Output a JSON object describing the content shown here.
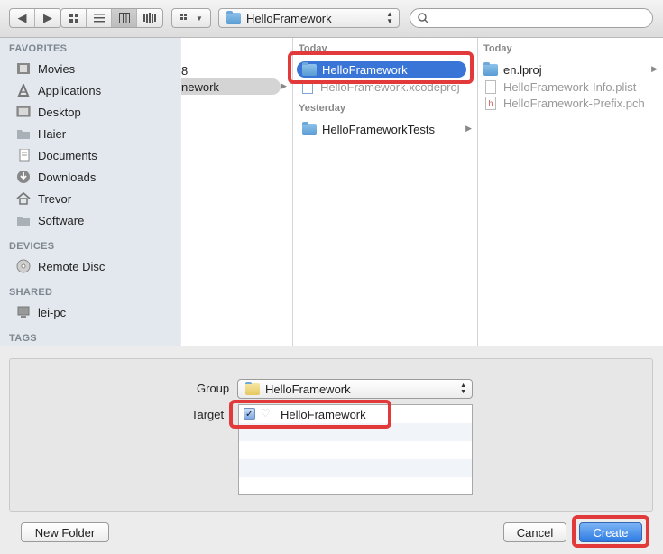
{
  "toolbar": {
    "path_label": "HelloFramework",
    "search_placeholder": ""
  },
  "sidebar": {
    "favorites_header": "FAVORITES",
    "favorites": [
      "Movies",
      "Applications",
      "Desktop",
      "Haier",
      "Documents",
      "Downloads",
      "Trevor",
      "Software"
    ],
    "devices_header": "DEVICES",
    "devices": [
      "Remote Disc"
    ],
    "shared_header": "SHARED",
    "shared": [
      "lei-pc"
    ],
    "tags_header": "TAGS"
  },
  "columns": {
    "col1": {
      "items": [
        "8",
        "nework"
      ]
    },
    "col2": {
      "today_header": "Today",
      "today": [
        "HelloFramework",
        "HelloFramework.xcodeproj"
      ],
      "yesterday_header": "Yesterday",
      "yesterday": [
        "HelloFrameworkTests"
      ]
    },
    "col3": {
      "today_header": "Today",
      "items": [
        "en.lproj",
        "HelloFramework-Info.plist",
        "HelloFramework-Prefix.pch"
      ],
      "pch_badge": "h"
    }
  },
  "options": {
    "group_label": "Group",
    "group_value": "HelloFramework",
    "targets_label": "Target",
    "target_item": "HelloFramework",
    "target_checked": true
  },
  "footer": {
    "new_folder": "New Folder",
    "cancel": "Cancel",
    "create": "Create"
  },
  "colors": {
    "selection": "#3875d7",
    "highlight_box": "#e2393a"
  }
}
